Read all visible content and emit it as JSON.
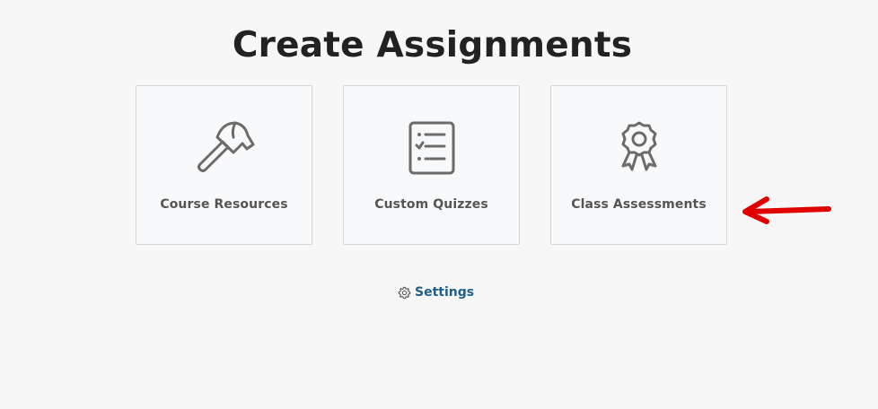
{
  "page": {
    "title": "Create Assignments"
  },
  "cards": [
    {
      "label": "Course Resources",
      "icon": "hammer-icon"
    },
    {
      "label": "Custom Quizzes",
      "icon": "checklist-icon"
    },
    {
      "label": "Class Assessments",
      "icon": "award-ribbon-icon"
    }
  ],
  "settings": {
    "label": "Settings",
    "icon": "gear-icon"
  },
  "colors": {
    "background": "#f7f7f7",
    "card_background": "#f8f9fa",
    "card_border": "#d4d6d9",
    "icon": "#6b6b6b",
    "link": "#1f5f8b",
    "annotation_arrow": "#e00000"
  }
}
